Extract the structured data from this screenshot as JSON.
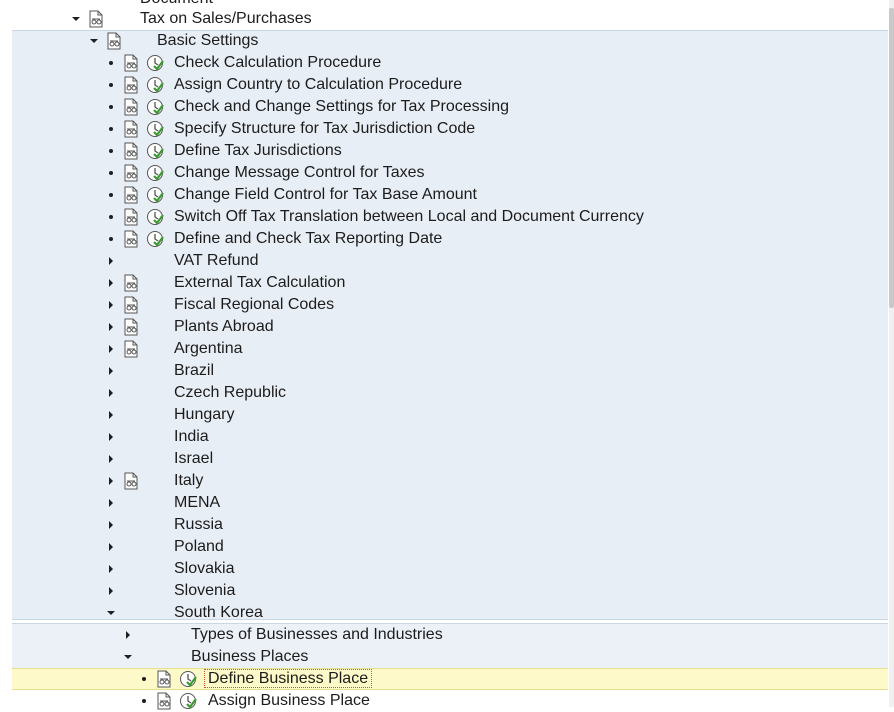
{
  "tree": {
    "top_partial": "Document",
    "tax_node": "Tax on Sales/Purchases",
    "basic_settings": "Basic Settings",
    "activities": [
      "Check Calculation Procedure",
      "Assign Country to Calculation Procedure",
      "Check and Change Settings for Tax Processing",
      "Specify Structure for Tax Jurisdiction Code",
      "Define Tax Jurisdictions",
      "Change Message Control for Taxes",
      "Change Field Control for Tax Base Amount",
      "Switch Off Tax Translation between Local and Document Currency",
      "Define and Check Tax Reporting Date"
    ],
    "folders": [
      {
        "label": "VAT Refund",
        "doc": false
      },
      {
        "label": "External Tax Calculation",
        "doc": true
      },
      {
        "label": "Fiscal Regional Codes",
        "doc": true
      },
      {
        "label": "Plants Abroad",
        "doc": true
      },
      {
        "label": "Argentina",
        "doc": true
      },
      {
        "label": "Brazil",
        "doc": false
      },
      {
        "label": "Czech Republic",
        "doc": false
      },
      {
        "label": "Hungary",
        "doc": false
      },
      {
        "label": "India",
        "doc": false
      },
      {
        "label": "Israel",
        "doc": false
      },
      {
        "label": "Italy",
        "doc": true
      },
      {
        "label": "MENA",
        "doc": false
      },
      {
        "label": "Russia",
        "doc": false
      },
      {
        "label": "Poland",
        "doc": false
      },
      {
        "label": "Slovakia",
        "doc": false
      },
      {
        "label": "Slovenia",
        "doc": false
      }
    ],
    "south_korea": "South Korea",
    "types_of_businesses": "Types of Businesses and Industries",
    "business_places": "Business Places",
    "define_business_place": "Define Business Place",
    "assign_business_place": "Assign Business Place"
  },
  "colors": {
    "band": "#e8eef6",
    "selected_row": "#fdf9c8",
    "exec_icon_green": "#3a9a2f"
  },
  "icons": {
    "doc": "documentation-icon",
    "execute": "execute-activity-icon"
  }
}
